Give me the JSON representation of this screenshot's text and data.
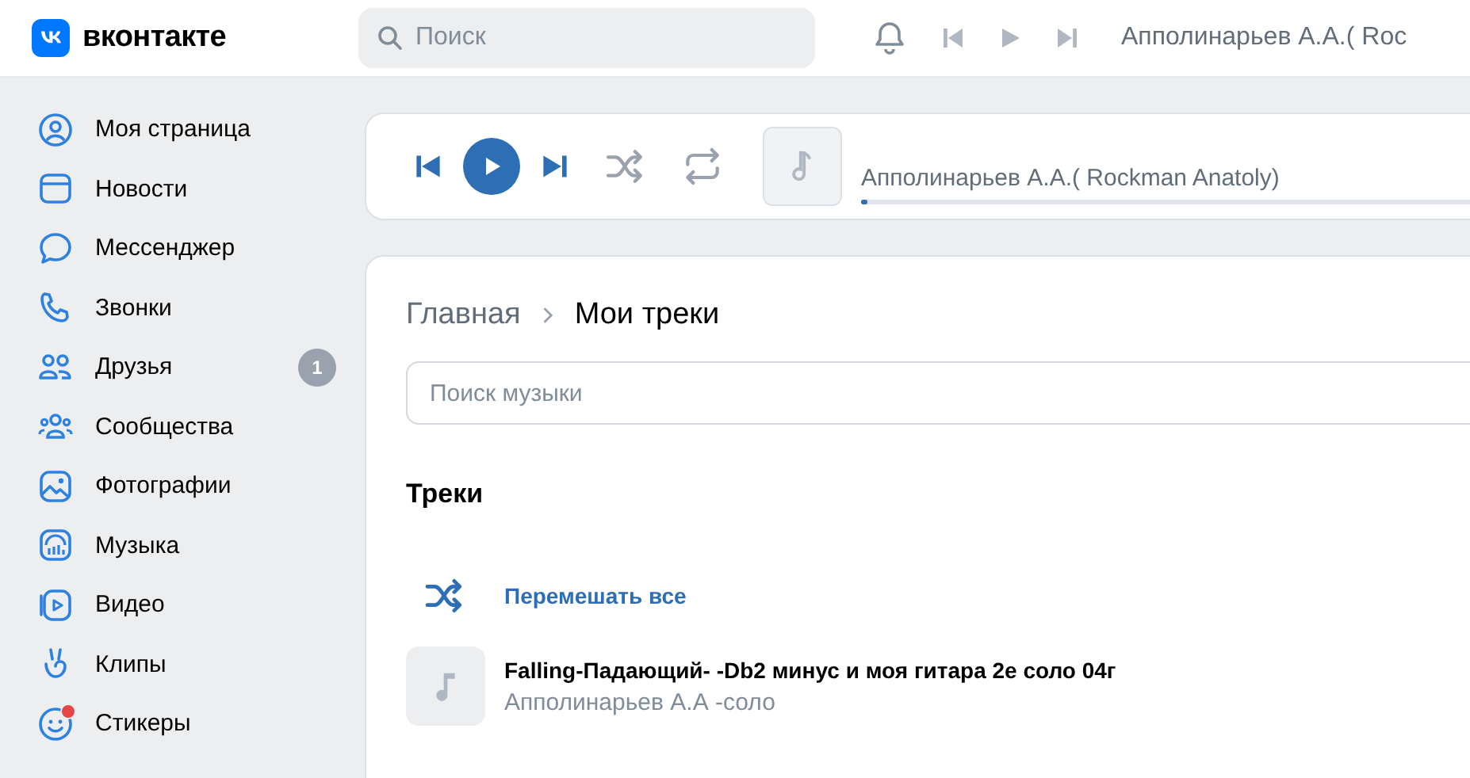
{
  "header": {
    "logo_text": "вконтакте",
    "search": {
      "placeholder": "Поиск"
    },
    "now_playing": "Апполинарьев А.А.( Roc"
  },
  "sidebar": {
    "items": [
      {
        "kind": "profile",
        "label": "Моя страница",
        "dot": false
      },
      {
        "kind": "news",
        "label": "Новости",
        "dot": false
      },
      {
        "kind": "messenger",
        "label": "Мессенджер",
        "dot": false
      },
      {
        "kind": "calls",
        "label": "Звонки",
        "dot": false
      },
      {
        "kind": "friends",
        "label": "Друзья",
        "badge": "1",
        "dot": false
      },
      {
        "kind": "communities",
        "label": "Сообщества",
        "dot": false
      },
      {
        "kind": "photos",
        "label": "Фотографии",
        "dot": false
      },
      {
        "kind": "music",
        "label": "Музыка",
        "dot": false
      },
      {
        "kind": "video",
        "label": "Видео",
        "dot": false
      },
      {
        "kind": "clips",
        "label": "Клипы",
        "dot": false
      },
      {
        "kind": "stickers",
        "label": "Стикеры",
        "dot": true
      }
    ]
  },
  "player": {
    "playing": false,
    "track_title": "Апполинарьев А.А.( Rockman Anatoly)",
    "level": 0.01
  },
  "breadcrumbs": [
    {
      "label": "Главная",
      "current": false
    },
    {
      "label": "Мои треки",
      "current": true
    }
  ],
  "music_search": {
    "placeholder": "Поиск музыки"
  },
  "section_title": "Треки",
  "shuffle_all": "Перемешать все",
  "tracks": [
    {
      "title": "Falling-Падающий- -Db2 минус и моя гитара 2е соло 04г",
      "artist": "Апполинарьев А.А -соло"
    }
  ]
}
